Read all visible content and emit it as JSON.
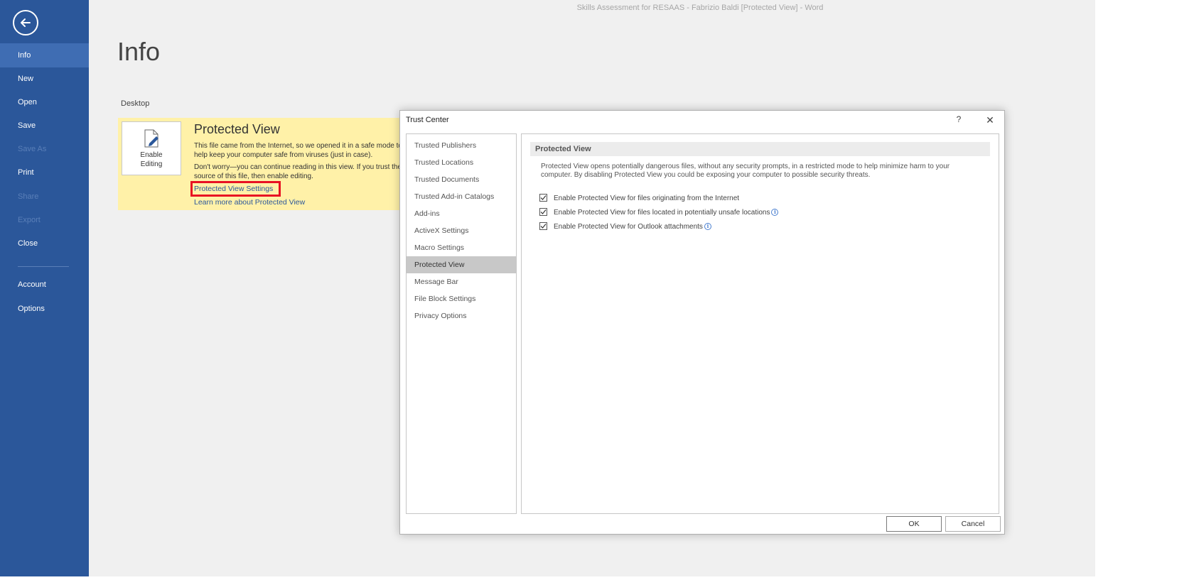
{
  "window": {
    "title": "Skills Assessment for RESAAS -  Fabrizio Baldi [Protected View] - Word"
  },
  "sidebar": {
    "items": [
      {
        "label": "Info",
        "state": "active"
      },
      {
        "label": "New",
        "state": "normal"
      },
      {
        "label": "Open",
        "state": "normal"
      },
      {
        "label": "Save",
        "state": "normal"
      },
      {
        "label": "Save As",
        "state": "disabled"
      },
      {
        "label": "Print",
        "state": "normal"
      },
      {
        "label": "Share",
        "state": "disabled"
      },
      {
        "label": "Export",
        "state": "disabled"
      },
      {
        "label": "Close",
        "state": "normal"
      },
      {
        "label": "Account",
        "state": "normal"
      },
      {
        "label": "Options",
        "state": "normal"
      }
    ]
  },
  "info": {
    "title": "Info",
    "location": "Desktop",
    "banner": {
      "enable_editing": "Enable Editing",
      "heading": "Protected View",
      "text_1": "This file came from the Internet, so we opened it in a safe mode to help keep your computer safe from viruses (just in case).",
      "text_2": "Don't worry—you can continue reading in this view. If you trust the source of this file, then enable editing.",
      "settings_link": "Protected View Settings",
      "learn_link": "Learn more about Protected View"
    }
  },
  "dialog": {
    "title": "Trust Center",
    "help": "?",
    "close": "✕",
    "categories": [
      {
        "label": "Trusted Publishers",
        "selected": false
      },
      {
        "label": "Trusted Locations",
        "selected": false
      },
      {
        "label": "Trusted Documents",
        "selected": false
      },
      {
        "label": "Trusted Add-in Catalogs",
        "selected": false
      },
      {
        "label": "Add-ins",
        "selected": false
      },
      {
        "label": "ActiveX Settings",
        "selected": false
      },
      {
        "label": "Macro Settings",
        "selected": false
      },
      {
        "label": "Protected View",
        "selected": true
      },
      {
        "label": "Message Bar",
        "selected": false
      },
      {
        "label": "File Block Settings",
        "selected": false
      },
      {
        "label": "Privacy Options",
        "selected": false
      }
    ],
    "section_title": "Protected View",
    "description": "Protected View opens potentially dangerous files, without any security prompts, in a restricted mode to help minimize harm to your computer. By disabling Protected View you could be exposing your computer to possible security threats.",
    "options": [
      {
        "label": "Enable Protected View for files originating from the Internet",
        "checked": true,
        "info": false
      },
      {
        "label": "Enable Protected View for files located in potentially unsafe locations",
        "checked": true,
        "info": true
      },
      {
        "label": "Enable Protected View for Outlook attachments",
        "checked": true,
        "info": true
      }
    ],
    "ok": "OK",
    "cancel": "Cancel"
  },
  "colors": {
    "sidebar_bg": "#2b579a",
    "sidebar_active": "#3f6db3",
    "banner_bg": "#fff1a8",
    "highlight_box": "#e81123",
    "link": "#2b579a"
  }
}
